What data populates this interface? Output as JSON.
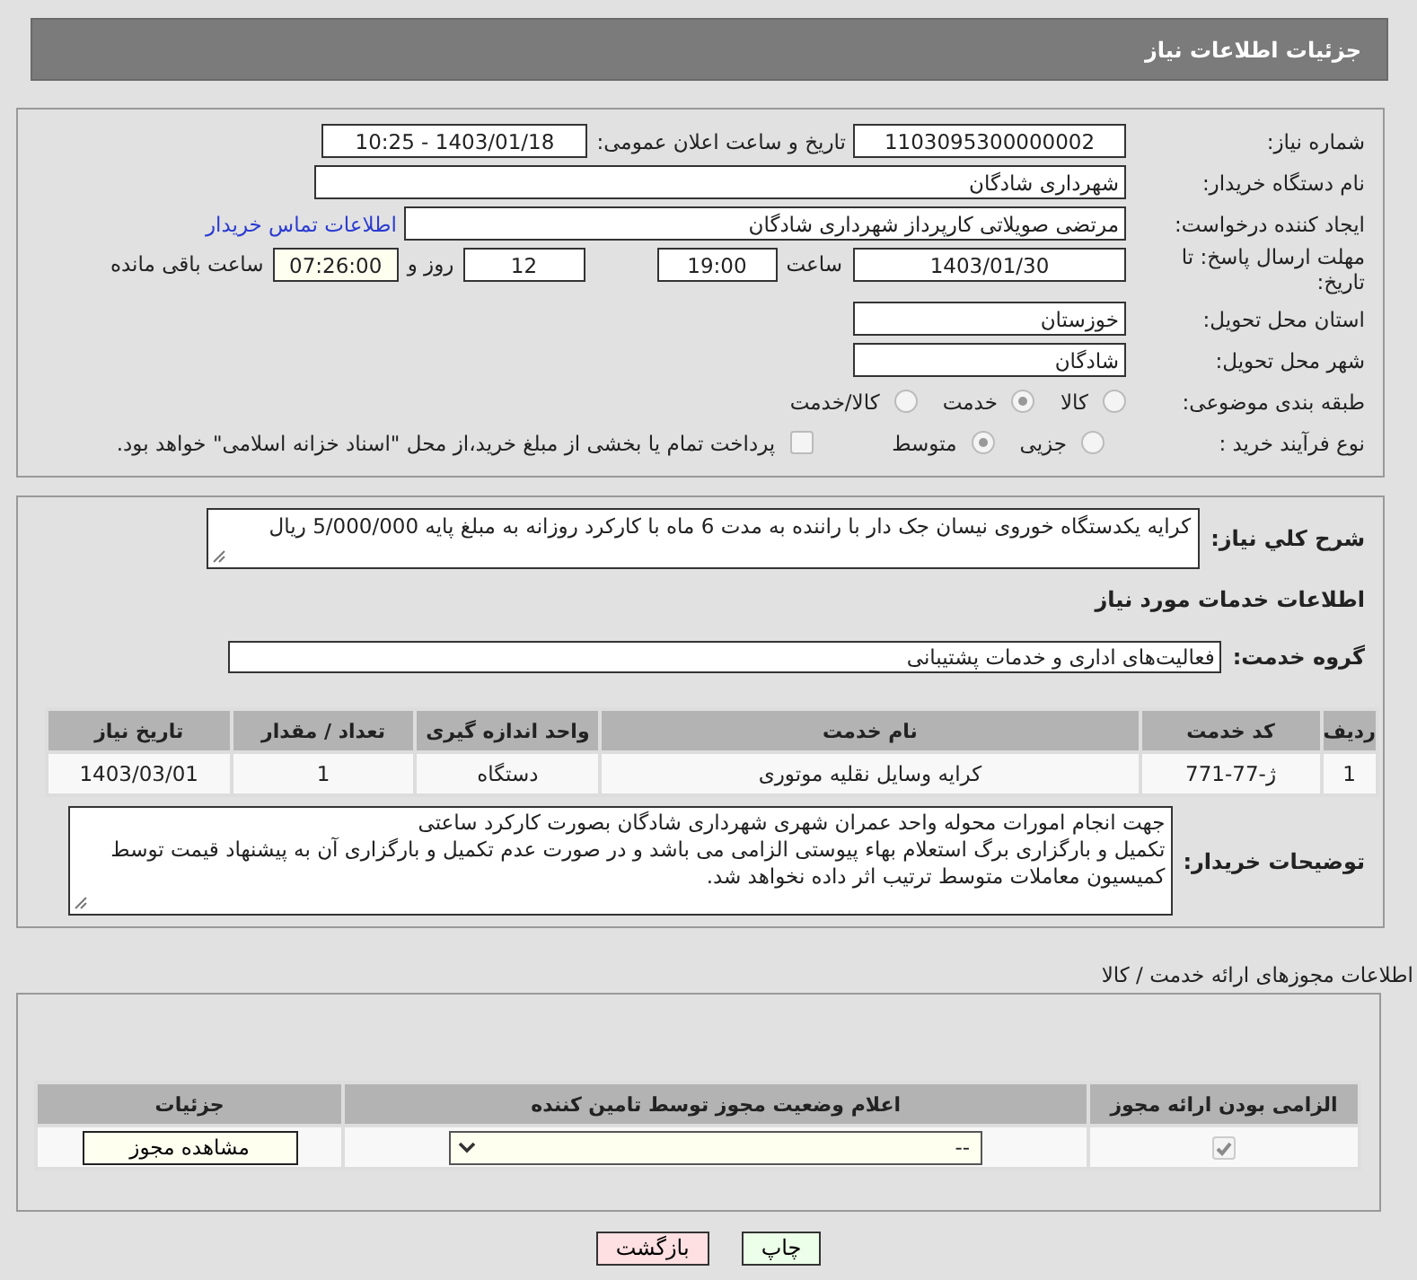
{
  "header": {
    "title": "جزئیات اطلاعات نیاز"
  },
  "details": {
    "need_number": {
      "label": "شماره نیاز:",
      "value": "1103095300000002"
    },
    "announce": {
      "label": "تاریخ و ساعت اعلان عمومی:",
      "value": "1403/01/18 - 10:25"
    },
    "buyer_org": {
      "label": "نام دستگاه خریدار:",
      "value": "شهرداری شادگان"
    },
    "requester": {
      "label": "ایجاد کننده درخواست:",
      "value": "مرتضی صویلاتی کارپرداز شهرداری شادگان",
      "link": "اطلاعات تماس خریدار"
    },
    "deadline": {
      "label": "مهلت ارسال پاسخ: تا تاریخ:",
      "date": "1403/01/30",
      "time_label": "ساعت",
      "time": "19:00",
      "days": "12",
      "days_label": "روز و",
      "remaining": "07:26:00",
      "remaining_label": "ساعت باقی مانده"
    },
    "province": {
      "label": "استان محل تحویل:",
      "value": "خوزستان"
    },
    "city": {
      "label": "شهر محل تحویل:",
      "value": "شادگان"
    },
    "category": {
      "label": "طبقه بندی موضوعی:",
      "options": [
        {
          "label": "کالا",
          "selected": false
        },
        {
          "label": "خدمت",
          "selected": true
        },
        {
          "label": "کالا/خدمت",
          "selected": false
        }
      ]
    },
    "process": {
      "label": "نوع فرآیند خرید :",
      "options": [
        {
          "label": "جزیی",
          "selected": false
        },
        {
          "label": "متوسط",
          "selected": true
        }
      ],
      "payment": {
        "checked": false,
        "text": "پرداخت تمام یا بخشی از مبلغ خرید،از محل \"اسناد خزانه اسلامی\" خواهد بود."
      }
    }
  },
  "description": {
    "label": "شرح کلي نياز:",
    "value": "کرایه یکدستگاه خوروی نیسان جک دار با راننده به مدت 6 ماه با کارکرد روزانه به مبلغ پایه 5/000/000 ریال"
  },
  "services_heading": "اطلاعات خدمات مورد نیاز",
  "service_group": {
    "label": "گروه خدمت:",
    "value": "فعالیت‌های اداری و خدمات پشتیبانی"
  },
  "service_table": {
    "columns": [
      "ردیف",
      "کد خدمت",
      "نام خدمت",
      "واحد اندازه گیری",
      "تعداد / مقدار",
      "تاریخ نیاز"
    ],
    "rows": [
      [
        "1",
        "ژ-77-771",
        "کرایه وسایل نقلیه موتوری",
        "دستگاه",
        "1",
        "1403/03/01"
      ]
    ]
  },
  "buyer_notes": {
    "label": "توضیحات خریدار:",
    "value": "جهت انجام امورات محوله واحد عمران شهری شهرداری شادگان بصورت کارکرد ساعتی\nتکمیل و بارگزاری برگ استعلام بهاء پیوستی الزامی می باشد و در صورت عدم تکمیل و بارگزاری آن به پیشنهاد قیمت توسط کمیسیون معاملات متوسط ترتیب اثر داده نخواهد شد."
  },
  "permits": {
    "title": "اطلاعات مجوزهای ارائه خدمت / کالا",
    "columns": [
      "الزامی بودن ارائه مجوز",
      "اعلام وضعیت مجوز توسط تامین کننده",
      "جزئیات"
    ],
    "rows": [
      {
        "required": true,
        "status": "--",
        "button": "مشاهده مجوز"
      }
    ]
  },
  "buttons": [
    {
      "label": "چاپ",
      "kind": "print"
    },
    {
      "label": "بازگشت",
      "kind": "back"
    }
  ]
}
